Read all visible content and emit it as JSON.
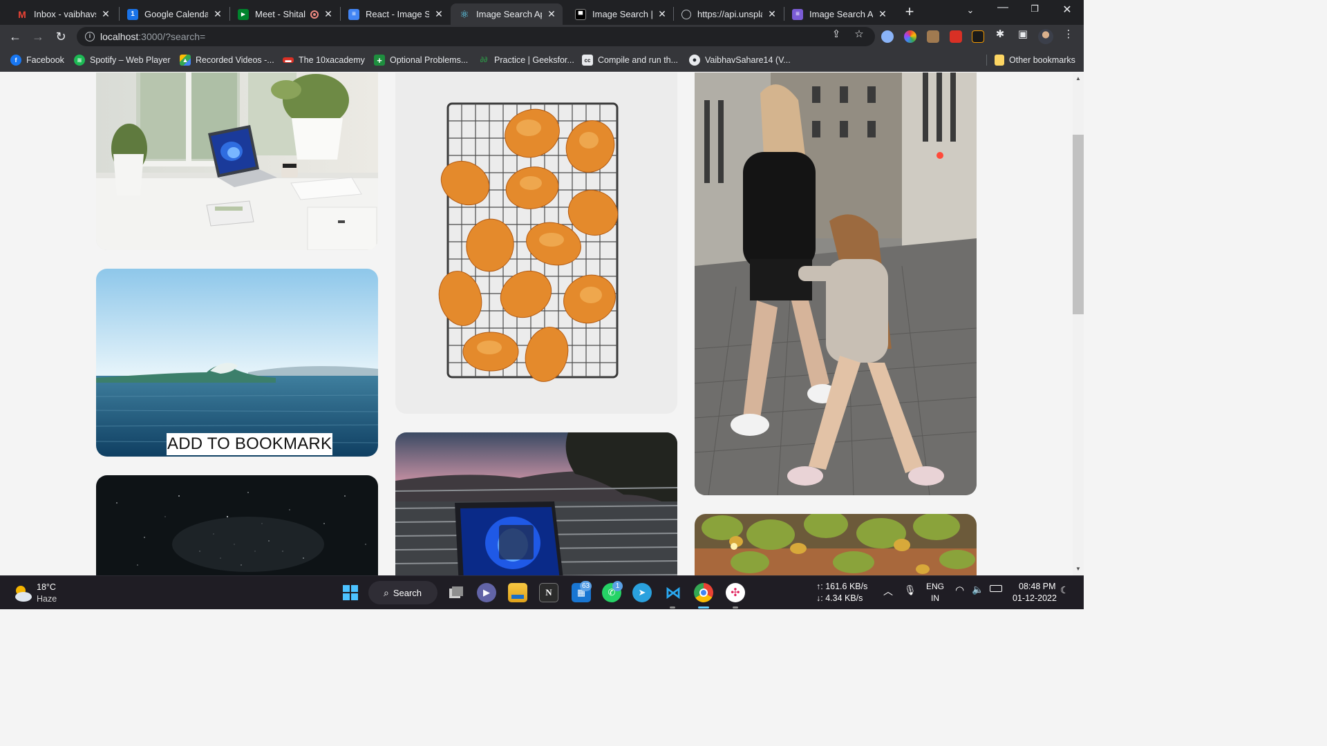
{
  "browser": {
    "tabs": [
      {
        "title": "Inbox - vaibhavsa",
        "icon": "gmail-icon",
        "color": "#ea4335",
        "glyph": "M"
      },
      {
        "title": "Google Calendar",
        "icon": "calendar-icon",
        "color": "#1a73e8",
        "glyph": "1"
      },
      {
        "title": "Meet - Shital",
        "icon": "meet-icon",
        "color": "#00832d",
        "glyph": "▶"
      },
      {
        "title": "React - Image Sea",
        "icon": "docs-icon",
        "color": "#4285f4",
        "glyph": "≡"
      },
      {
        "title": "Image Search App",
        "icon": "react-icon",
        "color": "#35363a",
        "glyph": "⚛",
        "active": true
      },
      {
        "title": "Image Search | Un",
        "icon": "unsplash-icon",
        "color": "#000000",
        "glyph": "▀"
      },
      {
        "title": "https://api.unspla",
        "icon": "globe-icon",
        "color": "#5f6368",
        "glyph": "◯"
      },
      {
        "title": "Image Search App",
        "icon": "list-icon",
        "color": "#7b5cd6",
        "glyph": "≡"
      }
    ],
    "url_host": "localhost",
    "url_path": ":3000/?search=",
    "bookmarks": [
      {
        "label": "Facebook",
        "icon": "facebook-icon",
        "color": "#1877f2",
        "glyph": "f"
      },
      {
        "label": "Spotify – Web Player",
        "icon": "spotify-icon",
        "color": "#1db954",
        "glyph": "≋"
      },
      {
        "label": "Recorded Videos -...",
        "icon": "drive-icon",
        "color": "#f4b400",
        "glyph": "▲"
      },
      {
        "label": "The 10xacademy",
        "icon": "10x-icon",
        "color": "#d93025",
        "glyph": "▬"
      },
      {
        "label": "Optional Problems...",
        "icon": "plus-icon",
        "color": "#1e8e3e",
        "glyph": "+"
      },
      {
        "label": "Practice | Geeksfor...",
        "icon": "geeksforgeeks-icon",
        "color": "#2f8d46",
        "glyph": "∂"
      },
      {
        "label": "Compile and run th...",
        "icon": "compiler-icon",
        "color": "#5f6368",
        "glyph": "cc"
      },
      {
        "label": "VaibhavSahare14 (V...",
        "icon": "github-icon",
        "color": "#24292f",
        "glyph": "●"
      }
    ],
    "other_bookmarks": "Other bookmarks"
  },
  "gallery": {
    "overlay_label": "ADD TO BOOKMARK",
    "images": [
      {
        "name": "laptop-by-window-photo",
        "column": 1
      },
      {
        "name": "ocean-wave-photo",
        "column": 1
      },
      {
        "name": "starry-night-photo",
        "column": 1
      },
      {
        "name": "bread-rolls-on-rack-photo",
        "column": 2
      },
      {
        "name": "laptop-sunset-balcony-photo",
        "column": 2
      },
      {
        "name": "mother-daughter-walking-photo",
        "column": 3
      },
      {
        "name": "autumn-leaves-photo",
        "column": 3
      }
    ]
  },
  "taskbar": {
    "weather_temp": "18°C",
    "weather_desc": "Haze",
    "search_label": "Search",
    "teams_badge": "63",
    "whatsapp_badge": "1",
    "net_up": "↑: 161.6 KB/s",
    "net_down": "↓: 4.34 KB/s",
    "lang": "ENG",
    "region": "IN",
    "time": "08:48 PM",
    "date": "01-12-2022"
  }
}
